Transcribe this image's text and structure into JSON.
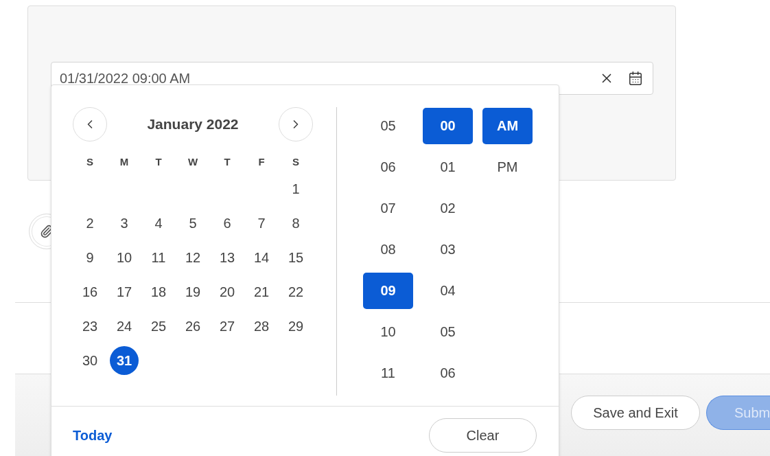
{
  "date_field": {
    "value": "01/31/2022 09:00 AM"
  },
  "calendar": {
    "title": "January 2022",
    "weekdays": [
      "S",
      "M",
      "T",
      "W",
      "T",
      "F",
      "S"
    ],
    "weeks": [
      [
        {
          "day": "1",
          "selected": false
        }
      ],
      [
        {
          "day": "2",
          "selected": false
        },
        {
          "day": "3",
          "selected": false
        },
        {
          "day": "4",
          "selected": false
        },
        {
          "day": "5",
          "selected": false
        },
        {
          "day": "6",
          "selected": false
        },
        {
          "day": "7",
          "selected": false
        },
        {
          "day": "8",
          "selected": false
        }
      ],
      [
        {
          "day": "9",
          "selected": false
        },
        {
          "day": "10",
          "selected": false
        },
        {
          "day": "11",
          "selected": false
        },
        {
          "day": "12",
          "selected": false
        },
        {
          "day": "13",
          "selected": false
        },
        {
          "day": "14",
          "selected": false
        },
        {
          "day": "15",
          "selected": false
        }
      ],
      [
        {
          "day": "16",
          "selected": false
        },
        {
          "day": "17",
          "selected": false
        },
        {
          "day": "18",
          "selected": false
        },
        {
          "day": "19",
          "selected": false
        },
        {
          "day": "20",
          "selected": false
        },
        {
          "day": "21",
          "selected": false
        },
        {
          "day": "22",
          "selected": false
        }
      ],
      [
        {
          "day": "23",
          "selected": false
        },
        {
          "day": "24",
          "selected": false
        },
        {
          "day": "25",
          "selected": false
        },
        {
          "day": "26",
          "selected": false
        },
        {
          "day": "27",
          "selected": false
        },
        {
          "day": "28",
          "selected": false
        },
        {
          "day": "29",
          "selected": false
        }
      ],
      [
        {
          "day": "30",
          "selected": false
        },
        {
          "day": "31",
          "selected": true
        }
      ]
    ]
  },
  "time": {
    "hours": [
      {
        "label": "05",
        "selected": false
      },
      {
        "label": "06",
        "selected": false
      },
      {
        "label": "07",
        "selected": false
      },
      {
        "label": "08",
        "selected": false
      },
      {
        "label": "09",
        "selected": true
      },
      {
        "label": "10",
        "selected": false
      },
      {
        "label": "11",
        "selected": false
      }
    ],
    "minutes": [
      {
        "label": "00",
        "selected": true
      },
      {
        "label": "01",
        "selected": false
      },
      {
        "label": "02",
        "selected": false
      },
      {
        "label": "03",
        "selected": false
      },
      {
        "label": "04",
        "selected": false
      },
      {
        "label": "05",
        "selected": false
      },
      {
        "label": "06",
        "selected": false
      }
    ],
    "periods": [
      {
        "label": "AM",
        "selected": true
      },
      {
        "label": "PM",
        "selected": false
      }
    ]
  },
  "picker_footer": {
    "today": "Today",
    "clear": "Clear"
  },
  "footer": {
    "buttons": [
      {
        "label": "Save and Exit",
        "kind": "secondary",
        "disabled": false
      },
      {
        "label": "Subm",
        "kind": "primary",
        "disabled": true
      }
    ]
  }
}
